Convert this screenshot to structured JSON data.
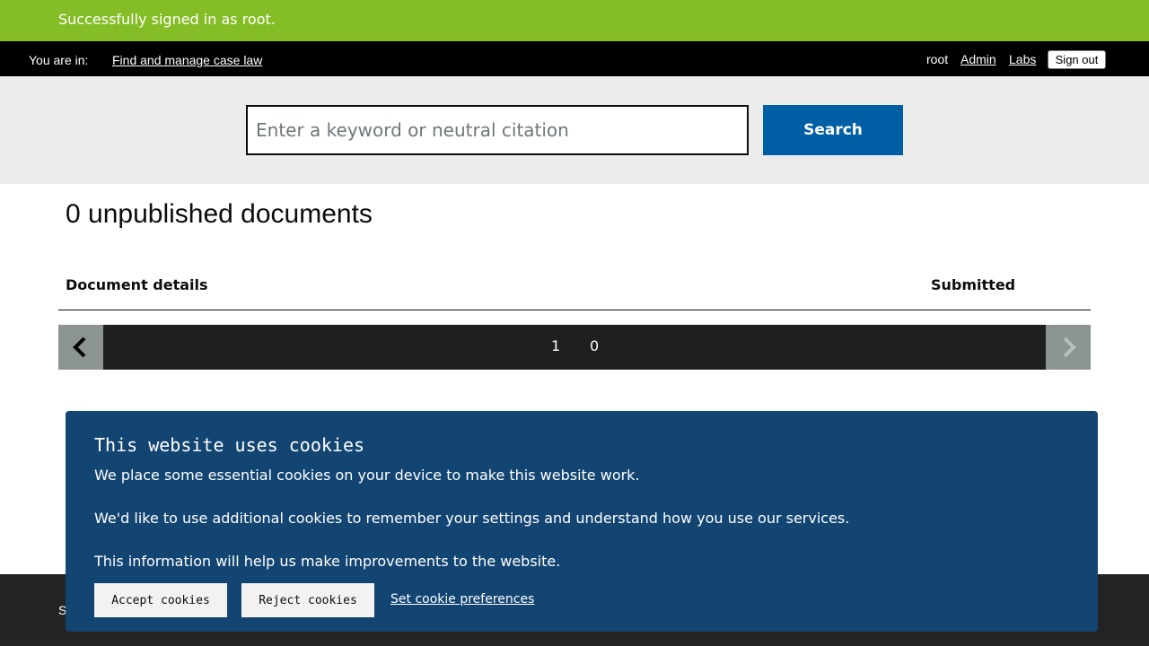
{
  "flash": {
    "message": "Successfully signed in as root."
  },
  "topbar": {
    "you_are_in": "You are in:",
    "breadcrumb_link": "Find and manage case law",
    "user": "root",
    "admin_link": "Admin",
    "labs_link": "Labs",
    "sign_out": "Sign out"
  },
  "search": {
    "placeholder": "Enter a keyword or neutral citation",
    "value": "",
    "button_label": "Search"
  },
  "main": {
    "heading": "0 unpublished documents",
    "columns": [
      "Document details",
      "Submitted"
    ]
  },
  "pagination": {
    "pages": [
      "1",
      "0"
    ],
    "prev_icon": "chevron-left-icon",
    "next_icon": "chevron-right-icon"
  },
  "footer": {
    "text_visible": "S"
  },
  "cookie_banner": {
    "title": "This website uses cookies",
    "paragraphs": [
      "We place some essential cookies on your device to make this website work.",
      "We'd like to use additional cookies to remember your settings and understand how you use our services.",
      "This information will help us make improvements to the website."
    ],
    "accept_label": "Accept cookies",
    "reject_label": "Reject cookies",
    "preferences_label": "Set cookie preferences"
  },
  "colors": {
    "flash": "#85bd27",
    "topbar": "#000000",
    "search_band": "#ececec",
    "primary_button": "#005ea5",
    "pager": "#1f1f1f",
    "pager_arrow_bg": "#8c9492",
    "cookie_banner": "#134572",
    "footer": "#232323"
  }
}
